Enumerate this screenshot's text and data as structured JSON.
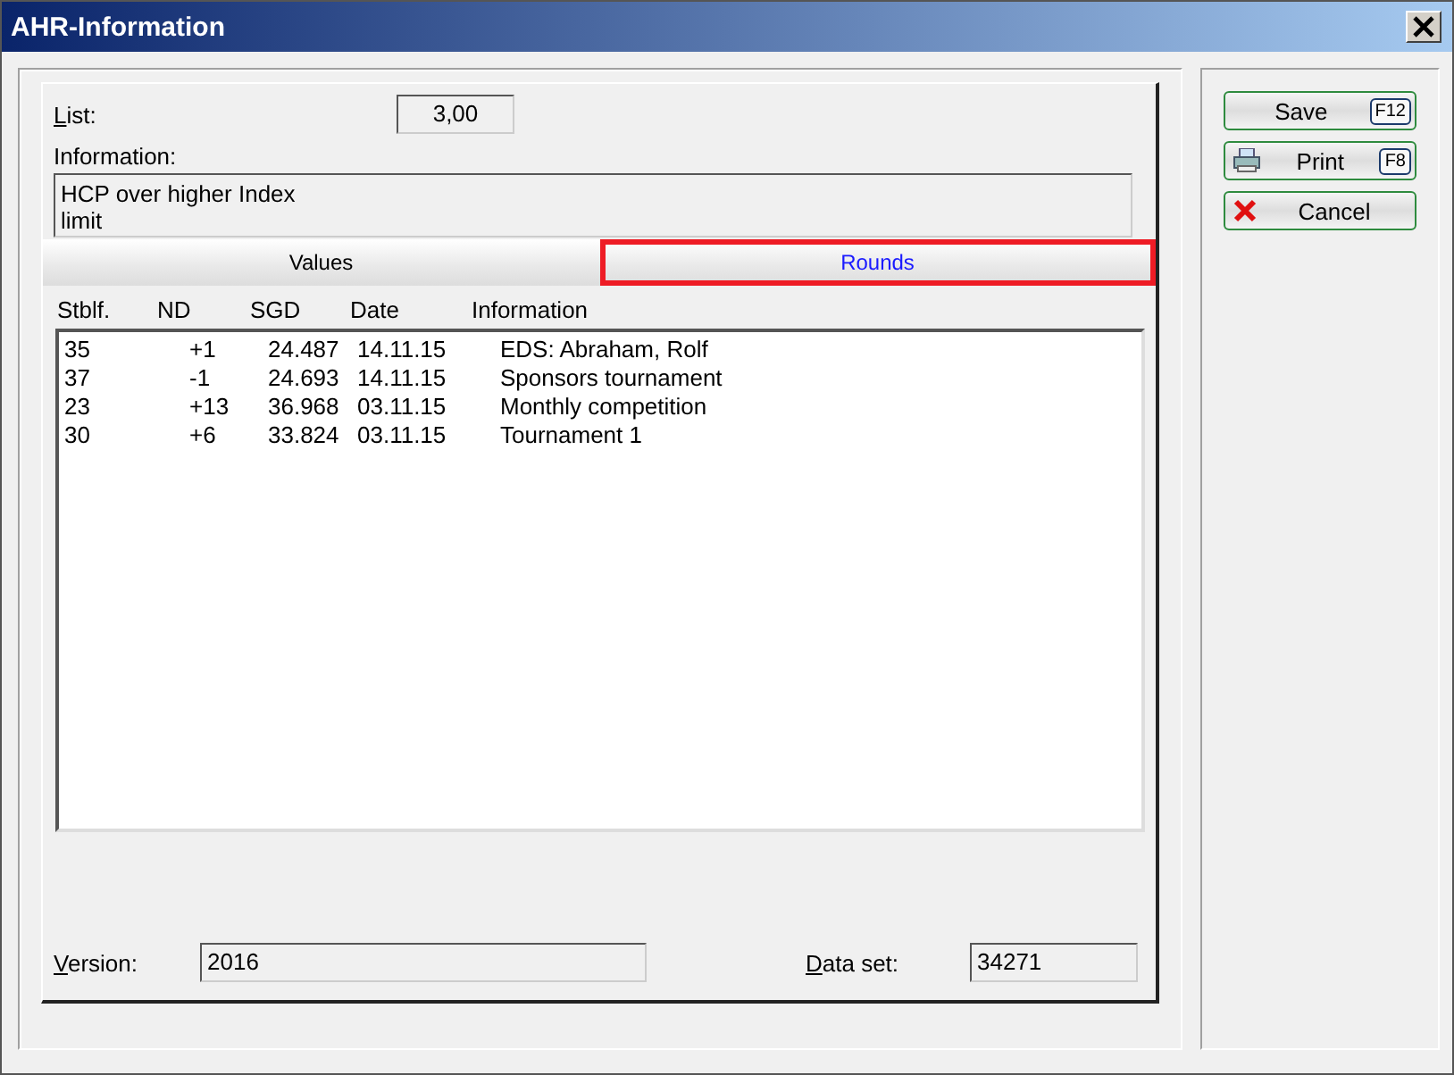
{
  "window": {
    "title": "AHR-Information"
  },
  "list": {
    "label": "List:",
    "value": "3,00"
  },
  "information": {
    "label": "Information:",
    "value": "HCP over higher Index limit"
  },
  "tabs": [
    {
      "label": "Values",
      "selected": false,
      "highlighted": false
    },
    {
      "label": "Rounds",
      "selected": true,
      "highlighted": true
    }
  ],
  "table": {
    "columns": [
      "Stblf.",
      "ND",
      "SGD",
      "Date",
      "Information"
    ],
    "rows": [
      [
        "35",
        "+1",
        "24.487",
        "14.11.15",
        "EDS: Abraham, Rolf"
      ],
      [
        "37",
        "-1",
        "24.693",
        "14.11.15",
        "Sponsors tournament"
      ],
      [
        "23",
        "+13",
        "36.968",
        "03.11.15",
        "Monthly competition"
      ],
      [
        "30",
        "+6",
        "33.824",
        "03.11.15",
        "Tournament 1"
      ]
    ]
  },
  "version": {
    "label": "Version:",
    "value": "2016"
  },
  "data_set": {
    "label": "Data set:",
    "value": "34271"
  },
  "buttons": [
    {
      "label": "Save",
      "key": "F12",
      "kind": "plain"
    },
    {
      "label": "Print",
      "key": "F8",
      "kind": "print"
    },
    {
      "label": "Cancel",
      "kind": "cancel"
    }
  ]
}
